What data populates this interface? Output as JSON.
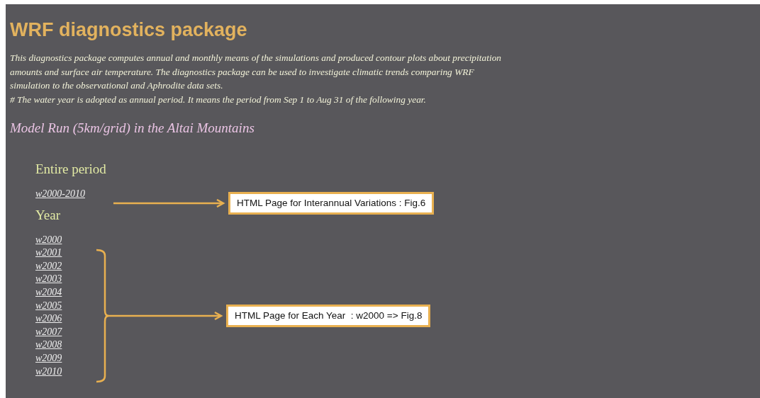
{
  "title": "WRF diagnostics package",
  "intro": [
    "This diagnostics package computes annual and monthly means of the simulations and produced contour plots about precipitation amounts and surface air temperature. The diagnostics package can be used to investigate climatic trends comparing WRF simulation to the observational and Aphrodite data sets.",
    "# The water year is adopted as annual period. It means the period from Sep 1 to Aug 31 of the following year."
  ],
  "subtitle": "Model Run (5km/grid) in the Altai Mountains",
  "sections": [
    {
      "heading": "Entire period",
      "links": [
        "w2000-2010"
      ]
    },
    {
      "heading": "Year",
      "links": [
        "w2000",
        "w2001",
        "w2002",
        "w2003",
        "w2004",
        "w2005",
        "w2006",
        "w2007",
        "w2008",
        "w2009",
        "w2010"
      ]
    }
  ],
  "callouts": [
    {
      "kind": "arrow",
      "text": "HTML Page for Interannual Variations : Fig.6"
    },
    {
      "kind": "bracket",
      "text": "HTML Page for Each Year  : w2000 => Fig.8"
    }
  ]
}
